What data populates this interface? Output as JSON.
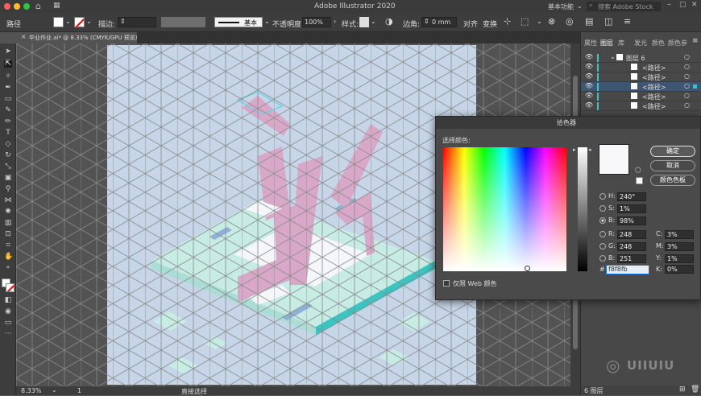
{
  "app": {
    "title": "Adobe Illustrator 2020",
    "workspace": "基本功能",
    "search_placeholder": "搜索 Adobe Stock"
  },
  "control_bar": {
    "selection": "路径",
    "stroke_label": "描边:",
    "stroke_profile": "基本",
    "opacity_label": "不透明度:",
    "opacity_value": "100%",
    "style_label": "样式:",
    "corner_label": "边角:",
    "corner_value": "0 mm",
    "align_label": "对齐",
    "transform_label": "变换"
  },
  "document": {
    "tab_title": "毕业作业.ai* @ 8.33% (CMYK/GPU 预览)"
  },
  "status_bar": {
    "zoom": "8.33%",
    "artboard_number": "1",
    "tool_name": "直接选择"
  },
  "layers_panel": {
    "tabs": [
      "属性",
      "图层",
      "库",
      "发光",
      "颜色",
      "颜色参"
    ],
    "active_tab": "图层",
    "rows": [
      {
        "label": "图层 6",
        "type": "layer"
      },
      {
        "label": "<路径>",
        "type": "path"
      },
      {
        "label": "<路径>",
        "type": "path"
      },
      {
        "label": "<路径>",
        "type": "path",
        "selected": true
      },
      {
        "label": "<路径>",
        "type": "path"
      },
      {
        "label": "<路径>",
        "type": "path"
      }
    ],
    "footer_count": "6 图层"
  },
  "color_picker": {
    "title": "拾色器",
    "select_label": "选择颜色:",
    "buttons": {
      "ok": "确定",
      "cancel": "取消",
      "swatches": "颜色色板"
    },
    "hsb": {
      "h_label": "H:",
      "h": "240°",
      "s_label": "S:",
      "s": "1%",
      "b_label": "B:",
      "b": "98%"
    },
    "rgb": {
      "r_label": "R:",
      "r": "248",
      "g_label": "G:",
      "g": "248",
      "b_label": "B:",
      "b": "251"
    },
    "cmyk": {
      "c_label": "C:",
      "c": "3%",
      "m_label": "M:",
      "m": "3%",
      "y_label": "Y:",
      "y": "1%",
      "k_label": "K:",
      "k": "0%"
    },
    "hex_label": "#",
    "hex": "f8f8fb",
    "web_only_label": "仅限 Web 颜色",
    "current_color": "#f8f8fb",
    "selected_mode": "B"
  },
  "watermark": {
    "text": "UIIUIU"
  },
  "colors": {
    "accent": "#1473e6",
    "artboard": "#c6d6e8",
    "art_pink": "#d9a8c9",
    "art_mint": "#c6ece4",
    "art_teal": "#39c6c2",
    "art_blue": "#8fb0d6"
  }
}
